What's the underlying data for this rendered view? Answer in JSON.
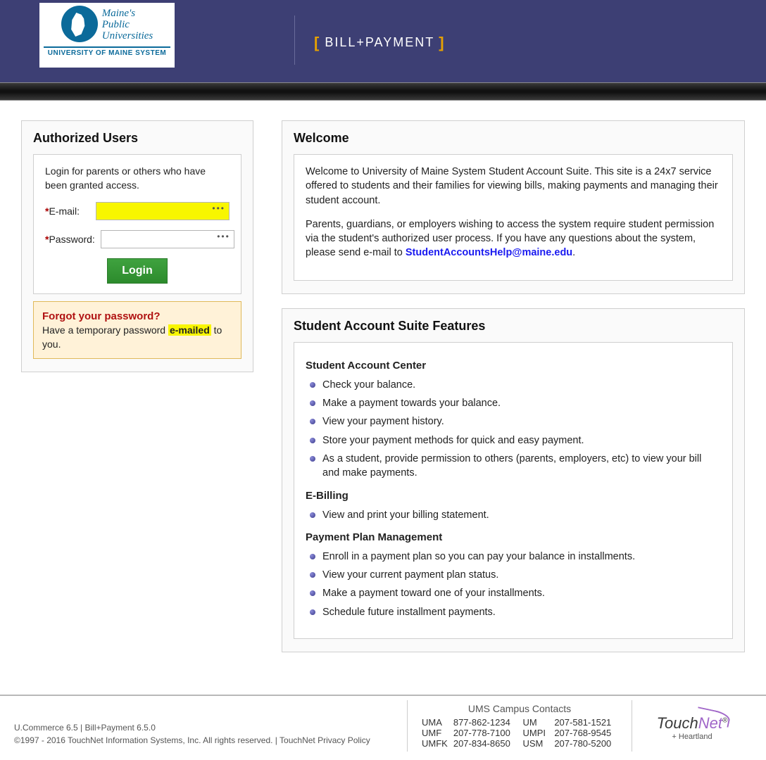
{
  "header": {
    "org_line1": "Maine's",
    "org_line2": "Public",
    "org_line3": "Universities",
    "org_sub": "UNIVERSITY OF MAINE SYSTEM",
    "app_title": "BILL+PAYMENT"
  },
  "login": {
    "panel_title": "Authorized Users",
    "description": "Login for parents or others who have been granted access.",
    "email_label": "E-mail:",
    "password_label": "Password:",
    "button": "Login",
    "email_value": "",
    "password_value": "",
    "forgot_title": "Forgot your password?",
    "forgot_pre": "Have a temporary password ",
    "forgot_hl": "e-mailed",
    "forgot_post": " to you."
  },
  "welcome": {
    "title": "Welcome",
    "p1": "Welcome to University of Maine System Student Account Suite. This site is a 24x7 service offered to students and their families for viewing bills, making payments and managing their student account.",
    "p2_pre": "Parents, guardians, or employers wishing to access the system require student permission via the student's authorized user process. If you have any questions about the system, please send e-mail to ",
    "p2_link": "StudentAccountsHelp@maine.edu",
    "p2_post": "."
  },
  "features": {
    "title": "Student Account Suite Features",
    "sec1_title": "Student Account Center",
    "sec1_items": [
      "Check your balance.",
      "Make a payment towards your balance.",
      "View your payment history.",
      "Store your payment methods for quick and easy payment.",
      "As a student, provide permission to others (parents, employers, etc) to view your bill and make payments."
    ],
    "sec2_title": "E-Billing",
    "sec2_items": [
      "View and print your billing statement."
    ],
    "sec3_title": "Payment Plan Management",
    "sec3_items": [
      "Enroll in a payment plan so you can pay your balance in installments.",
      "View your current payment plan status.",
      "Make a payment toward one of your installments.",
      "Schedule future installment payments."
    ]
  },
  "footer": {
    "line1": "U.Commerce 6.5 | Bill+Payment 6.5.0",
    "line2_pre": "©1997 - 2016  TouchNet Information Systems, Inc. All rights reserved.  |  ",
    "privacy_link": "TouchNet Privacy Policy",
    "contacts_title": "UMS Campus Contacts",
    "contacts": [
      {
        "a": "UMA",
        "ap": "877-862-1234",
        "b": "UM",
        "bp": "207-581-1521"
      },
      {
        "a": "UMF",
        "ap": "207-778-7100",
        "b": "UMPI",
        "bp": "207-768-9545"
      },
      {
        "a": "UMFK",
        "ap": "207-834-8650",
        "b": "USM",
        "bp": "207-780-5200"
      }
    ],
    "vendor": "TouchNet",
    "vendor_sub": "+ Heartland"
  }
}
